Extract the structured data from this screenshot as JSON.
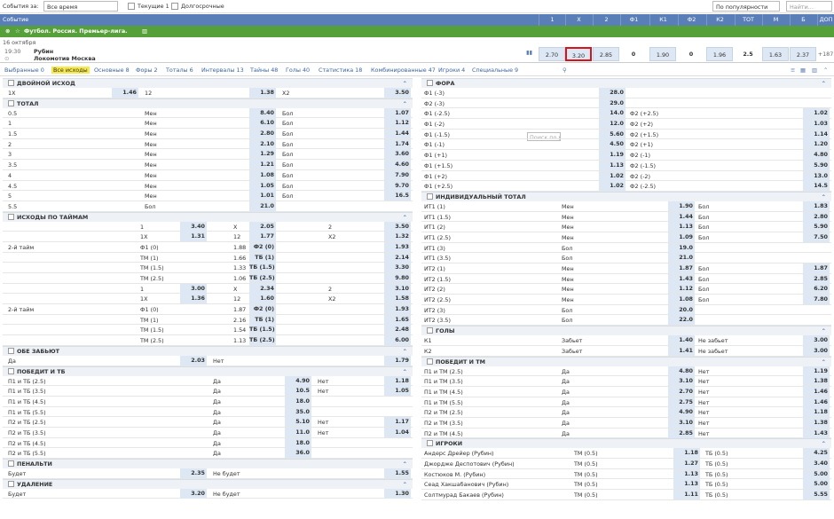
{
  "topbar": {
    "events_label": "События за:",
    "period": "Все время",
    "current_label": "Текущие 1",
    "long_label": "Долгосрочные",
    "sort": "По популярности",
    "find": "Найти..."
  },
  "header": {
    "title": "Событие",
    "cols": [
      "1",
      "X",
      "2",
      "Ф1",
      "К1",
      "Ф2",
      "К2",
      "ТОТ",
      "М",
      "Б",
      "ДОП"
    ]
  },
  "league": "Футбол. Россия. Премьер-лига.",
  "date": "16 октября",
  "match": {
    "time": "19:30",
    "team1": "Рубин",
    "team2": "Локомотив Москва",
    "odds": [
      "2.70",
      "3.20",
      "2.85",
      "0",
      "1.90",
      "0",
      "1.96",
      "2.5",
      "1.63",
      "2.37",
      "+187"
    ]
  },
  "tabs": [
    "Выбранные 0",
    "Все исходы",
    "Основные 8",
    "Форы 2",
    "Тоталы 6",
    "Интервалы 13",
    "Тайны 48",
    "Голы 40",
    "Статистика 18",
    "Комбинированные 47",
    "Игроки 4",
    "Специальные 9"
  ],
  "search_ph": "Поиск по р",
  "left": [
    {
      "t": "s",
      "name": "ДВОЙНОЙ ИСХОД"
    },
    {
      "t": "r",
      "c": [
        "1Х",
        "1.46",
        "12",
        "1.38",
        "Х2",
        "3.50"
      ]
    },
    {
      "t": "s",
      "name": "ТОТАЛ"
    },
    {
      "t": "r",
      "c": [
        "0.5",
        "",
        "Мен",
        "8.40",
        "Бол",
        "1.07"
      ]
    },
    {
      "t": "r",
      "c": [
        "1",
        "",
        "Мен",
        "6.10",
        "Бол",
        "1.12"
      ]
    },
    {
      "t": "r",
      "c": [
        "1.5",
        "",
        "Мен",
        "2.80",
        "Бол",
        "1.44"
      ]
    },
    {
      "t": "r",
      "c": [
        "2",
        "",
        "Мен",
        "2.10",
        "Бол",
        "1.74"
      ]
    },
    {
      "t": "r",
      "c": [
        "3",
        "",
        "Мен",
        "1.29",
        "Бол",
        "3.60"
      ]
    },
    {
      "t": "r",
      "c": [
        "3.5",
        "",
        "Мен",
        "1.21",
        "Бол",
        "4.60"
      ]
    },
    {
      "t": "r",
      "c": [
        "4",
        "",
        "Мен",
        "1.08",
        "Бол",
        "7.90"
      ]
    },
    {
      "t": "r",
      "c": [
        "4.5",
        "",
        "Мен",
        "1.05",
        "Бол",
        "9.70"
      ]
    },
    {
      "t": "r",
      "c": [
        "5",
        "",
        "Мен",
        "1.01",
        "Бол",
        "16.5"
      ]
    },
    {
      "t": "r",
      "c": [
        "5.5",
        "",
        "Бол",
        "21.0",
        "",
        ""
      ]
    },
    {
      "t": "s",
      "name": "ИСХОДЫ ПО ТАЙМАМ"
    },
    {
      "t": "h",
      "g": "",
      "c": [
        "1",
        "3.40",
        "X",
        "2.05",
        "2",
        "3.50"
      ]
    },
    {
      "t": "h",
      "g": "",
      "c": [
        "1X",
        "1.31",
        "12",
        "1.77",
        "X2",
        "1.32"
      ]
    },
    {
      "t": "h",
      "g": "2-й тайм",
      "c": [
        "Ф1 (0)",
        "",
        "1.88",
        "Ф2 (0)",
        "",
        "1.93"
      ]
    },
    {
      "t": "h",
      "g": "",
      "c": [
        "ТМ (1)",
        "",
        "1.66",
        "ТБ (1)",
        "",
        "2.14"
      ]
    },
    {
      "t": "h",
      "g": "",
      "c": [
        "ТМ (1.5)",
        "",
        "1.33",
        "ТБ (1.5)",
        "",
        "3.30"
      ]
    },
    {
      "t": "h",
      "g": "",
      "c": [
        "ТМ (2.5)",
        "",
        "1.06",
        "ТБ (2.5)",
        "",
        "9.80"
      ]
    },
    {
      "t": "h",
      "g": "",
      "c": [
        "1",
        "3.00",
        "X",
        "2.34",
        "2",
        "3.10"
      ]
    },
    {
      "t": "h",
      "g": "",
      "c": [
        "1X",
        "1.36",
        "12",
        "1.60",
        "X2",
        "1.58"
      ]
    },
    {
      "t": "h",
      "g": "2-й тайм",
      "c": [
        "Ф1 (0)",
        "",
        "1.87",
        "Ф2 (0)",
        "",
        "1.93"
      ]
    },
    {
      "t": "h",
      "g": "",
      "c": [
        "ТМ (1)",
        "",
        "2.16",
        "ТБ (1)",
        "",
        "1.65"
      ]
    },
    {
      "t": "h",
      "g": "",
      "c": [
        "ТМ (1.5)",
        "",
        "1.54",
        "ТБ (1.5)",
        "",
        "2.48"
      ]
    },
    {
      "t": "h",
      "g": "",
      "c": [
        "ТМ (2.5)",
        "",
        "1.13",
        "ТБ (2.5)",
        "",
        "6.00"
      ]
    },
    {
      "t": "s",
      "name": "ОБЕ ЗАБЬЮТ"
    },
    {
      "t": "b",
      "c": [
        "Да",
        "2.03",
        "Нет",
        "1.79"
      ]
    },
    {
      "t": "s",
      "name": "ПОБЕДИТ И ТБ"
    },
    {
      "t": "w",
      "c": [
        "П1 и ТБ (2.5)",
        "Да",
        "4.90",
        "Нет",
        "1.18"
      ]
    },
    {
      "t": "w",
      "c": [
        "П1 и ТБ (3.5)",
        "Да",
        "10.5",
        "Нет",
        "1.05"
      ]
    },
    {
      "t": "w",
      "c": [
        "П1 и ТБ (4.5)",
        "Да",
        "18.0",
        "",
        ""
      ]
    },
    {
      "t": "w",
      "c": [
        "П1 и ТБ (5.5)",
        "Да",
        "35.0",
        "",
        ""
      ]
    },
    {
      "t": "w",
      "c": [
        "П2 и ТБ (2.5)",
        "Да",
        "5.10",
        "Нет",
        "1.17"
      ]
    },
    {
      "t": "w",
      "c": [
        "П2 и ТБ (3.5)",
        "Да",
        "11.0",
        "Нет",
        "1.04"
      ]
    },
    {
      "t": "w",
      "c": [
        "П2 и ТБ (4.5)",
        "Да",
        "18.0",
        "",
        ""
      ]
    },
    {
      "t": "w",
      "c": [
        "П2 и ТБ (5.5)",
        "Да",
        "36.0",
        "",
        ""
      ]
    },
    {
      "t": "s",
      "name": "ПЕНАЛЬТИ"
    },
    {
      "t": "b",
      "c": [
        "Будет",
        "2.35",
        "Не будет",
        "1.55"
      ]
    },
    {
      "t": "s",
      "name": "УДАЛЕНИЕ"
    },
    {
      "t": "b",
      "c": [
        "Будет",
        "3.20",
        "Не будет",
        "1.30"
      ]
    }
  ],
  "right": [
    {
      "t": "s",
      "name": "ФОРА"
    },
    {
      "t": "f",
      "c": [
        "Ф1 (-3)",
        "28.0",
        "",
        ""
      ]
    },
    {
      "t": "f",
      "c": [
        "Ф2 (-3)",
        "29.0",
        "",
        ""
      ]
    },
    {
      "t": "f",
      "c": [
        "Ф1 (-2.5)",
        "14.0",
        "Ф2 (+2.5)",
        "1.02"
      ]
    },
    {
      "t": "f",
      "c": [
        "Ф1 (-2)",
        "12.0",
        "Ф2 (+2)",
        "1.03"
      ]
    },
    {
      "t": "f",
      "c": [
        "Ф1 (-1.5)",
        "5.60",
        "Ф2 (+1.5)",
        "1.14"
      ]
    },
    {
      "t": "f",
      "c": [
        "Ф1 (-1)",
        "4.50",
        "Ф2 (+1)",
        "1.20"
      ]
    },
    {
      "t": "f",
      "c": [
        "Ф1 (+1)",
        "1.19",
        "Ф2 (-1)",
        "4.80"
      ]
    },
    {
      "t": "f",
      "c": [
        "Ф1 (+1.5)",
        "1.13",
        "Ф2 (-1.5)",
        "5.90"
      ]
    },
    {
      "t": "f",
      "c": [
        "Ф1 (+2)",
        "1.02",
        "Ф2 (-2)",
        "13.0"
      ]
    },
    {
      "t": "f",
      "c": [
        "Ф1 (+2.5)",
        "1.02",
        "Ф2 (-2.5)",
        "14.5"
      ]
    },
    {
      "t": "s",
      "name": "ИНДИВИДУАЛЬНЫЙ ТОТАЛ"
    },
    {
      "t": "i",
      "c": [
        "ИТ1 (1)",
        "Мен",
        "1.90",
        "Бол",
        "1.83"
      ]
    },
    {
      "t": "i",
      "c": [
        "ИТ1 (1.5)",
        "Мен",
        "1.44",
        "Бол",
        "2.80"
      ]
    },
    {
      "t": "i",
      "c": [
        "ИТ1 (2)",
        "Мен",
        "1.13",
        "Бол",
        "5.90"
      ]
    },
    {
      "t": "i",
      "c": [
        "ИТ1 (2.5)",
        "Мен",
        "1.09",
        "Бол",
        "7.50"
      ]
    },
    {
      "t": "i",
      "c": [
        "ИТ1 (3)",
        "Бол",
        "19.0",
        "",
        ""
      ]
    },
    {
      "t": "i",
      "c": [
        "ИТ1 (3.5)",
        "Бол",
        "21.0",
        "",
        ""
      ]
    },
    {
      "t": "i",
      "c": [
        "ИТ2 (1)",
        "Мен",
        "1.87",
        "Бол",
        "1.87"
      ]
    },
    {
      "t": "i",
      "c": [
        "ИТ2 (1.5)",
        "Мен",
        "1.43",
        "Бол",
        "2.85"
      ]
    },
    {
      "t": "i",
      "c": [
        "ИТ2 (2)",
        "Мен",
        "1.12",
        "Бол",
        "6.20"
      ]
    },
    {
      "t": "i",
      "c": [
        "ИТ2 (2.5)",
        "Мен",
        "1.08",
        "Бол",
        "7.80"
      ]
    },
    {
      "t": "i",
      "c": [
        "ИТ2 (3)",
        "Бол",
        "20.0",
        "",
        ""
      ]
    },
    {
      "t": "i",
      "c": [
        "ИТ2 (3.5)",
        "Бол",
        "22.0",
        "",
        ""
      ]
    },
    {
      "t": "s",
      "name": "ГОЛЫ"
    },
    {
      "t": "i",
      "c": [
        "К1",
        "Забьет",
        "1.40",
        "Не забьет",
        "3.00"
      ]
    },
    {
      "t": "i",
      "c": [
        "К2",
        "Забьет",
        "1.41",
        "Не забьет",
        "3.00"
      ]
    },
    {
      "t": "s",
      "name": "ПОБЕДИТ И ТМ"
    },
    {
      "t": "i",
      "c": [
        "П1 и ТМ (2.5)",
        "Да",
        "4.80",
        "Нет",
        "1.19"
      ]
    },
    {
      "t": "i",
      "c": [
        "П1 и ТМ (3.5)",
        "Да",
        "3.10",
        "Нет",
        "1.38"
      ]
    },
    {
      "t": "i",
      "c": [
        "П1 и ТМ (4.5)",
        "Да",
        "2.70",
        "Нет",
        "1.46"
      ]
    },
    {
      "t": "i",
      "c": [
        "П1 и ТМ (5.5)",
        "Да",
        "2.75",
        "Нет",
        "1.46"
      ]
    },
    {
      "t": "i",
      "c": [
        "П2 и ТМ (2.5)",
        "Да",
        "4.90",
        "Нет",
        "1.18"
      ]
    },
    {
      "t": "i",
      "c": [
        "П2 и ТМ (3.5)",
        "Да",
        "3.10",
        "Нет",
        "1.38"
      ]
    },
    {
      "t": "i",
      "c": [
        "П2 и ТМ (4.5)",
        "Да",
        "2.85",
        "Нет",
        "1.43"
      ]
    },
    {
      "t": "s",
      "name": "ИГРОКИ"
    },
    {
      "t": "p",
      "c": [
        "Андерс Дрейер (Рубин)",
        "ТМ (0.5)",
        "1.18",
        "ТБ (0.5)",
        "4.25"
      ]
    },
    {
      "t": "p",
      "c": [
        "Джордже Деспотович (Рубин)",
        "ТМ (0.5)",
        "1.27",
        "ТБ (0.5)",
        "3.40"
      ]
    },
    {
      "t": "p",
      "c": [
        "Костюков М. (Рубин)",
        "ТМ (0.5)",
        "1.13",
        "ТБ (0.5)",
        "5.00"
      ]
    },
    {
      "t": "p",
      "c": [
        "Сеад Хакшабанович (Рубин)",
        "ТМ (0.5)",
        "1.13",
        "ТБ (0.5)",
        "5.00"
      ]
    },
    {
      "t": "p",
      "c": [
        "Солтмурад Бакаев (Рубин)",
        "ТМ (0.5)",
        "1.11",
        "ТБ (0.5)",
        "5.55"
      ]
    }
  ]
}
